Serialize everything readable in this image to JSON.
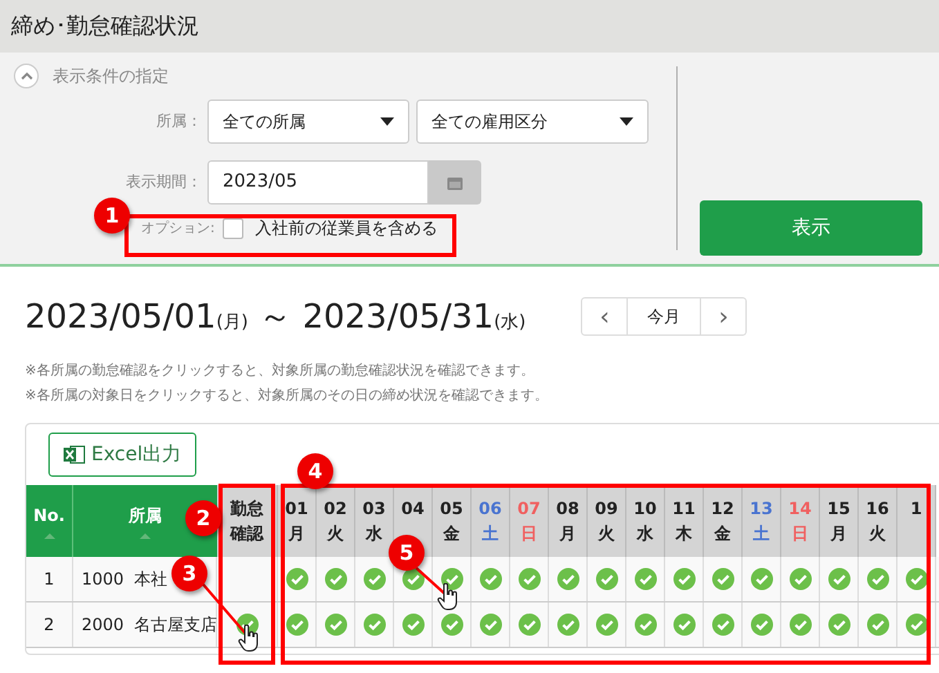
{
  "page_title": "締め･勤怠確認状況",
  "conditions": {
    "toggle_label": "表示条件の指定",
    "expanded": true,
    "dept_label": "所属：",
    "dept_value": "全ての所属",
    "employment_value": "全ての雇用区分",
    "period_label": "表示期間：",
    "period_value": "2023/05",
    "option_label": "オプション:",
    "option_text": "入社前の従業員を含める",
    "option_checked": false,
    "show_button": "表示"
  },
  "range": {
    "start": "2023/05/01",
    "start_dow": "(月)",
    "sep": "～",
    "end": "2023/05/31",
    "end_dow": "(水)"
  },
  "nav": {
    "prev": "‹",
    "today": "今月",
    "next": "›"
  },
  "notes": [
    "※各所属の勤怠確認をクリックすると、対象所属の勤怠確認状況を確認できます。",
    "※各所属の対象日をクリックすると、対象所属のその日の締め状況を確認できます。"
  ],
  "excel_button": "Excel出力",
  "table": {
    "columns": [
      "No.",
      "所属",
      "勤怠確認"
    ],
    "days": [
      {
        "day": "01",
        "dow": "月",
        "kind": "weekday"
      },
      {
        "day": "02",
        "dow": "火",
        "kind": "weekday"
      },
      {
        "day": "03",
        "dow": "水",
        "kind": "weekday"
      },
      {
        "day": "04",
        "kind": "weekday"
      },
      {
        "day": "05",
        "dow": "金",
        "kind": "weekday"
      },
      {
        "day": "06",
        "dow": "土",
        "kind": "saturday"
      },
      {
        "day": "07",
        "dow": "日",
        "kind": "sunday"
      },
      {
        "day": "08",
        "dow": "月",
        "kind": "weekday"
      },
      {
        "day": "09",
        "dow": "火",
        "kind": "weekday"
      },
      {
        "day": "10",
        "dow": "水",
        "kind": "weekday"
      },
      {
        "day": "11",
        "dow": "木",
        "kind": "weekday"
      },
      {
        "day": "12",
        "dow": "金",
        "kind": "weekday"
      },
      {
        "day": "13",
        "dow": "土",
        "kind": "saturday"
      },
      {
        "day": "14",
        "dow": "日",
        "kind": "sunday"
      },
      {
        "day": "15",
        "dow": "月",
        "kind": "weekday"
      },
      {
        "day": "16",
        "dow": "火",
        "kind": "weekday"
      },
      {
        "day": "1",
        "kind": "weekday"
      }
    ],
    "rows": [
      {
        "no": "1",
        "code": "1000",
        "dept": "本社",
        "confirmed": false,
        "days": [
          true,
          true,
          true,
          true,
          true,
          true,
          true,
          true,
          true,
          true,
          true,
          true,
          true,
          true,
          true,
          true,
          true
        ]
      },
      {
        "no": "2",
        "code": "2000",
        "dept": "名古屋支店",
        "confirmed": true,
        "days": [
          true,
          true,
          true,
          true,
          true,
          true,
          true,
          true,
          true,
          true,
          true,
          true,
          true,
          true,
          true,
          true,
          true
        ]
      }
    ]
  },
  "callouts": [
    "1",
    "2",
    "3",
    "4",
    "5"
  ]
}
